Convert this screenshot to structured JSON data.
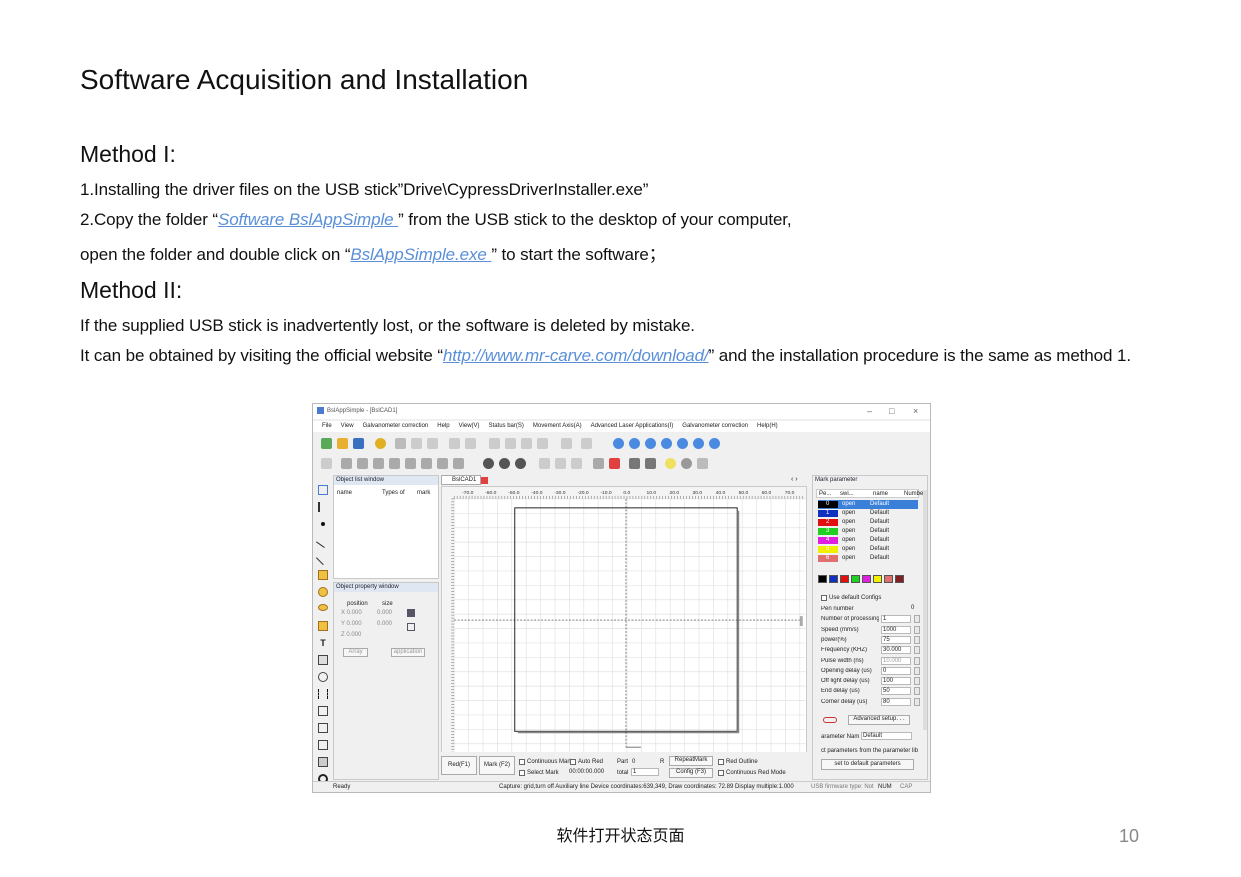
{
  "heading": "Software Acquisition and Installation",
  "method1": {
    "title": "Method I:",
    "line1": "1.Installing the driver files on the USB stick”Drive\\CypressDriverInstaller.exe”",
    "line2_pre": "2.Copy the folder “",
    "line2_link": "Software BslAppSimple ",
    "line2_post": "” from the USB stick to the desktop of your computer,",
    "line3_pre": "open the folder and double click on “",
    "line3_link": "BslAppSimple.exe ",
    "line3_post": "” to start the software；"
  },
  "method2": {
    "title": "Method II:",
    "line1": "If the supplied USB stick is inadvertently lost, or the software is deleted by mistake.",
    "line2_pre": "It can be obtained by visiting the official website “",
    "line2_link": "http://www.mr-carve.com/download/",
    "line2_post": "” and the installation procedure is the same as method 1."
  },
  "screenshot": {
    "window_title": "BslAppSimple - [BslCAD1]",
    "menu": [
      "File",
      "View",
      "Galvanometer correction",
      "Help",
      "View(V)",
      "Status bar(S)",
      "Movement Axis(A)",
      "Advanced Laser Applications(I)",
      "Galvanometer correction",
      "Help(H)"
    ],
    "object_list": {
      "title": "Object list window",
      "columns": [
        "name",
        "Types of",
        "mark"
      ]
    },
    "object_property": {
      "title": "Object property window",
      "position": "position",
      "size": "size",
      "x": "X 0.000",
      "xs": "0.000",
      "y": "Y 0.000",
      "ys": "0.000",
      "z": "Z 0.000",
      "array": "Array",
      "application": "application"
    },
    "canvas_tab": "BslCAD1",
    "ruler": [
      "-70.0",
      "-60.0",
      "-50.0",
      "-40.0",
      "-30.0",
      "-20.0",
      "-10.0",
      "0.0",
      "10.0",
      "20.0",
      "30.0",
      "40.0",
      "50.0",
      "60.0",
      "70.0"
    ],
    "mark_param": {
      "title": "Mark parameter",
      "cols": [
        "Pe...",
        "swi...",
        "name",
        "Numbe"
      ],
      "pens": [
        {
          "n": "0",
          "s": "open",
          "name": "Default",
          "color": "#000000"
        },
        {
          "n": "1",
          "s": "open",
          "name": "Default",
          "color": "#1030c0"
        },
        {
          "n": "2",
          "s": "open",
          "name": "Default",
          "color": "#e01010"
        },
        {
          "n": "3",
          "s": "open",
          "name": "Default",
          "color": "#20d020"
        },
        {
          "n": "4",
          "s": "open",
          "name": "Default",
          "color": "#e020e0"
        },
        {
          "n": "5",
          "s": "open",
          "name": "Default",
          "color": "#f0f000"
        },
        {
          "n": "6",
          "s": "open",
          "name": "Default",
          "color": "#e07070"
        }
      ],
      "use_default": "Use default Configs",
      "params": [
        {
          "label": "Pen number",
          "value": "0"
        },
        {
          "label": "Number of processing t",
          "value": "1"
        },
        {
          "label": "Speed (mm/s)",
          "value": "1000"
        },
        {
          "label": "power(%)",
          "value": "75"
        },
        {
          "label": "Frequency (KHZ)",
          "value": "30.000"
        },
        {
          "label": "Pulse width (ns)",
          "value": "10.000"
        },
        {
          "label": "Opening delay (us)",
          "value": "0"
        },
        {
          "label": "Off light delay (us)",
          "value": "100"
        },
        {
          "label": "End delay (us)",
          "value": "50"
        },
        {
          "label": "Corner delay (us)",
          "value": "80"
        }
      ],
      "advanced": "Advanced setup. . .",
      "param_name_label": "arameter Nam",
      "param_name_value": "Default",
      "from_lib": "ct parameters from the parameter lib",
      "set_default": "set to default parameters"
    },
    "bottom": {
      "red": "Red(F1)",
      "mark": "Mark (F2)",
      "continuous": "Continuous Mark",
      "autored": "Auto Red",
      "select": "Select Mark",
      "part_label": "Part",
      "part": "0",
      "r": "R",
      "time": "00:00:00.000",
      "total_label": "total",
      "total": "1",
      "repeat": "RepeatMark",
      "config": "Config (F3)",
      "redoutline": "Red Outline",
      "contred": "Continuous Red Mode"
    },
    "status": {
      "ready": "Ready",
      "capture": "Capture: grid,turn off Auxiliary line  Device coordinates:639,349,  Draw coordinates: 72.89  Display multiple:1.000",
      "usb": "USB firmware type: Not",
      "num": "NUM",
      "cap": "CAP"
    }
  },
  "caption": "软件打开状态页面",
  "page_number": "10"
}
